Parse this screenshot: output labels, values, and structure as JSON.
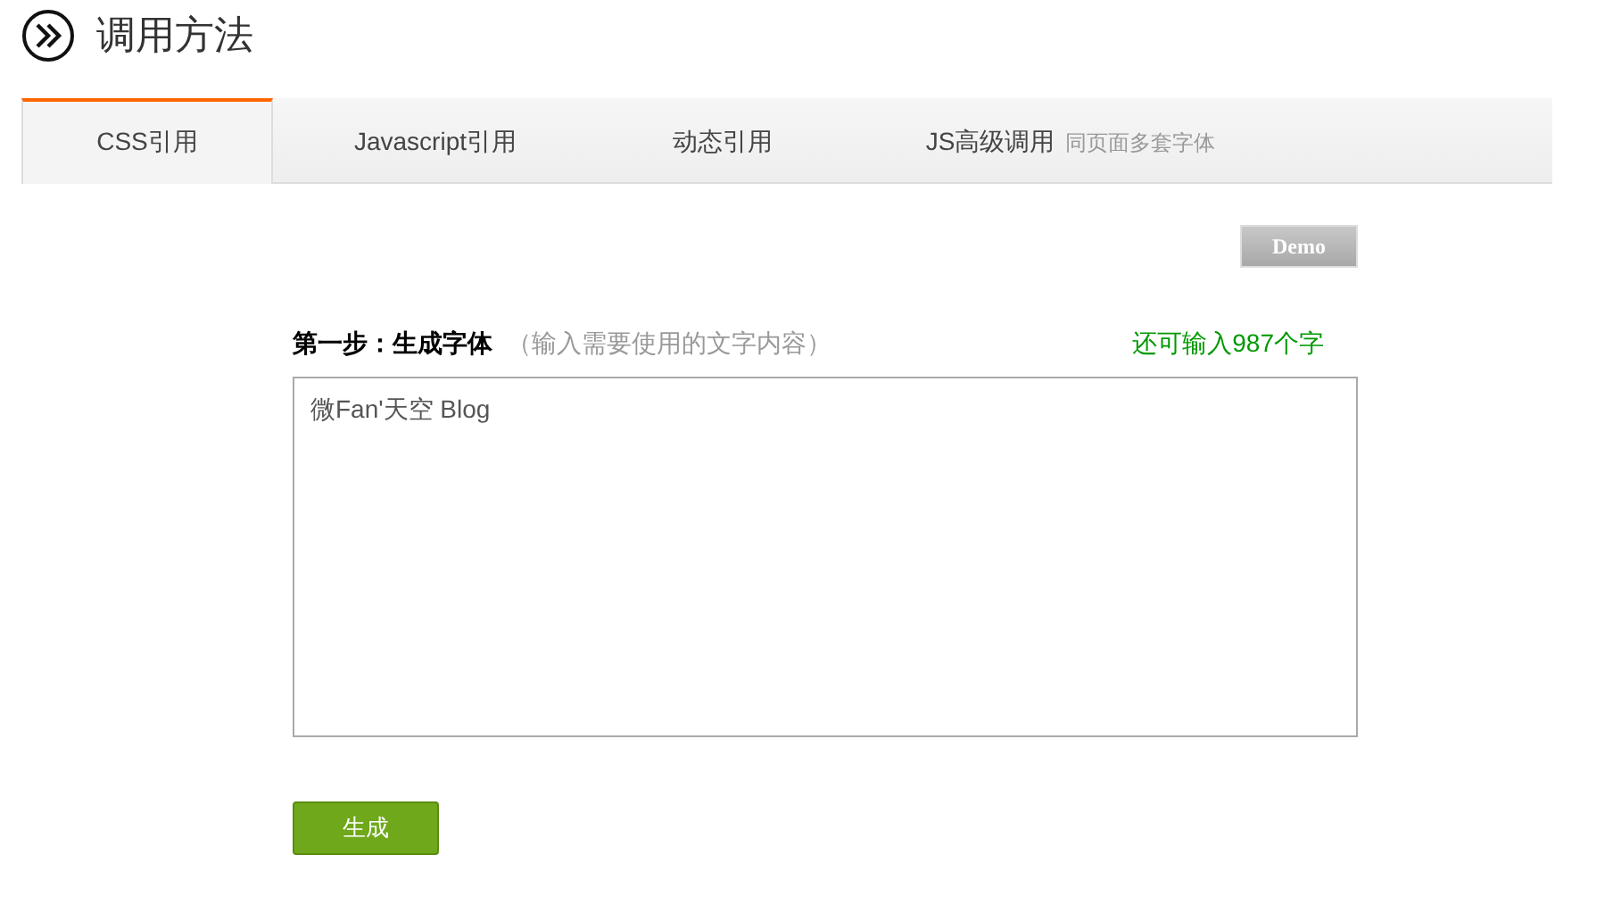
{
  "header": {
    "title": "调用方法"
  },
  "tabs": [
    {
      "label": "CSS引用",
      "selected": true
    },
    {
      "label": "Javascript引用",
      "selected": false
    },
    {
      "label": "动态引用",
      "selected": false
    },
    {
      "label": "JS高级调用",
      "note": "同页面多套字体",
      "selected": false
    }
  ],
  "demo_button": "Demo",
  "step": {
    "label": "第一步：生成字体",
    "hint": "（输入需要使用的文字内容）",
    "remaining": "还可输入987个字"
  },
  "textarea": {
    "value": "微Fan'天空 Blog"
  },
  "generate_button": "生成"
}
